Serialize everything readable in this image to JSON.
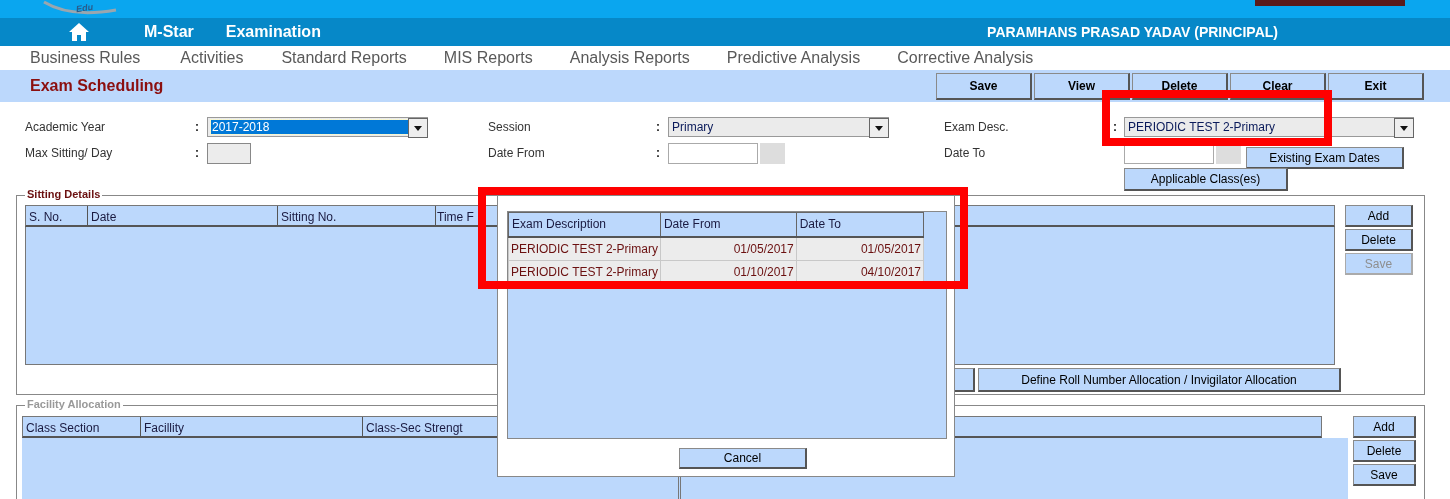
{
  "logo": {
    "text": "Edu"
  },
  "nav": {
    "app_name": "M-Star",
    "module": "Examination",
    "user": "PARAMHANS PRASAD YADAV (PRINCIPAL)"
  },
  "menu": [
    {
      "label": "Business Rules"
    },
    {
      "label": "Activities"
    },
    {
      "label": "Standard Reports"
    },
    {
      "label": "MIS Reports"
    },
    {
      "label": "Analysis Reports"
    },
    {
      "label": "Predictive Analysis"
    },
    {
      "label": "Corrective Analysis"
    }
  ],
  "page": {
    "title": "Exam Scheduling",
    "actions": [
      {
        "label": "Save"
      },
      {
        "label": "View"
      },
      {
        "label": "Delete"
      },
      {
        "label": "Clear"
      },
      {
        "label": "Exit"
      }
    ]
  },
  "form": {
    "fields": [
      {
        "label": "Academic Year",
        "colon": ":",
        "kind": "select",
        "value": "2017-2018",
        "focused": true
      },
      {
        "label": "Session",
        "colon": ":",
        "kind": "select",
        "value": "Primary",
        "focused": false
      },
      {
        "label": "Exam Desc.",
        "colon": ":",
        "kind": "select",
        "value": "PERIODIC TEST 2-Primary",
        "focused": false
      },
      {
        "label": "Max Sitting/ Day",
        "colon": ":",
        "kind": "text"
      },
      {
        "label": "Date From",
        "colon": ":",
        "kind": "date"
      },
      {
        "label": "Date To",
        "kind": "date",
        "button": "Existing Exam Dates"
      }
    ],
    "applicable_button": "Applicable Class(es)"
  },
  "sitting": {
    "title": "Sitting Details",
    "columns": [
      "S. No.",
      "Date",
      "Sitting No.",
      "Time F"
    ],
    "side_buttons": [
      {
        "label": "Add",
        "disabled": false
      },
      {
        "label": "Delete",
        "disabled": false
      },
      {
        "label": "Save",
        "disabled": true
      }
    ],
    "bottom_button": "Define Roll Number Allocation / Invigilator Allocation"
  },
  "facility": {
    "title": "Facility Allocation",
    "disabled": true,
    "columns": [
      "Class Section",
      "Facillity",
      "Class-Sec Strengt"
    ],
    "side_buttons": [
      {
        "label": "Add",
        "disabled": false
      },
      {
        "label": "Delete",
        "disabled": false
      },
      {
        "label": "Save",
        "disabled": false
      }
    ]
  },
  "dialog": {
    "columns": [
      "Exam Description",
      "Date From",
      "Date To"
    ],
    "rows": [
      [
        "PERIODIC TEST 2-Primary",
        "01/05/2017",
        "01/05/2017"
      ],
      [
        "PERIODIC TEST 2-Primary",
        "01/10/2017",
        "04/10/2017"
      ]
    ],
    "cancel": "Cancel"
  },
  "annotations": [
    {
      "kind": "frame"
    },
    {
      "kind": "frame"
    }
  ]
}
